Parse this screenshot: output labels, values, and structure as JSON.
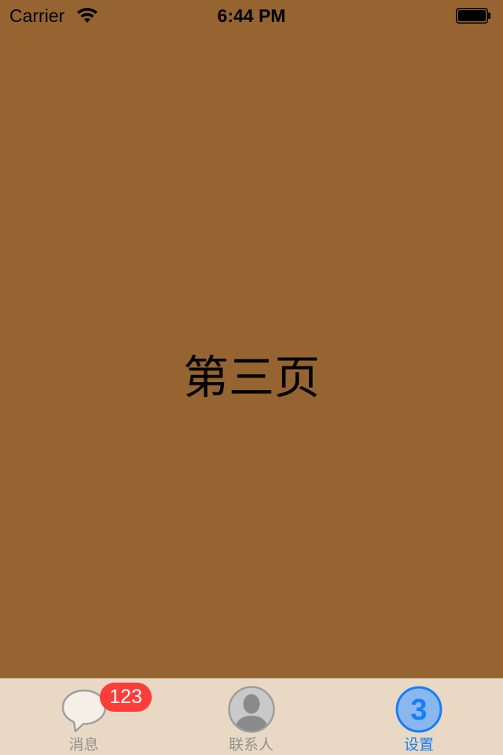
{
  "status_bar": {
    "carrier": "Carrier",
    "time": "6:44 PM",
    "wifi_icon": "wifi-icon",
    "battery_icon": "battery-full-icon"
  },
  "page": {
    "background_color": "#966431",
    "label": "第三页"
  },
  "tab_bar": {
    "background_color": "#e9d9c4",
    "active_color": "#157efb",
    "inactive_color": "#929292",
    "tabs": [
      {
        "label": "消息",
        "icon": "speech-bubble-icon",
        "badge": "123",
        "selected": false
      },
      {
        "label": "联系人",
        "icon": "person-icon",
        "selected": false
      },
      {
        "label": "设置",
        "icon": "number-3-icon",
        "icon_text": "3",
        "selected": true
      }
    ]
  }
}
